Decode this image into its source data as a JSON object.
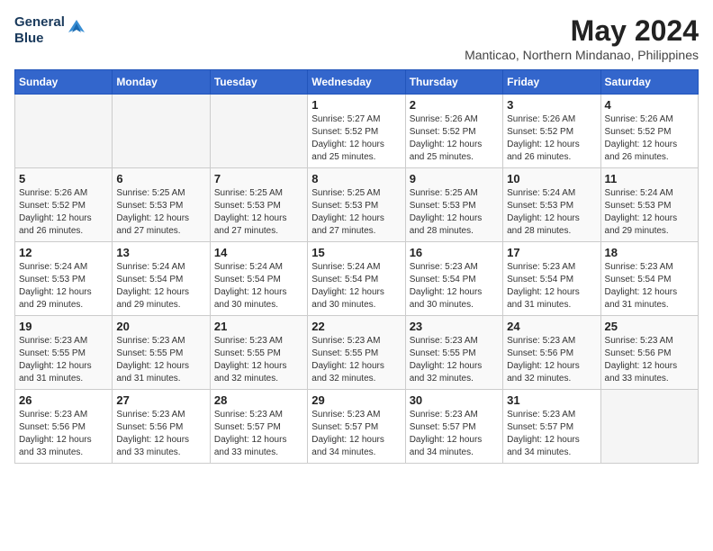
{
  "logo": {
    "line1": "General",
    "line2": "Blue"
  },
  "title": "May 2024",
  "location": "Manticao, Northern Mindanao, Philippines",
  "weekdays": [
    "Sunday",
    "Monday",
    "Tuesday",
    "Wednesday",
    "Thursday",
    "Friday",
    "Saturday"
  ],
  "weeks": [
    [
      {
        "day": "",
        "sunrise": "",
        "sunset": "",
        "daylight": ""
      },
      {
        "day": "",
        "sunrise": "",
        "sunset": "",
        "daylight": ""
      },
      {
        "day": "",
        "sunrise": "",
        "sunset": "",
        "daylight": ""
      },
      {
        "day": "1",
        "sunrise": "Sunrise: 5:27 AM",
        "sunset": "Sunset: 5:52 PM",
        "daylight": "Daylight: 12 hours and 25 minutes."
      },
      {
        "day": "2",
        "sunrise": "Sunrise: 5:26 AM",
        "sunset": "Sunset: 5:52 PM",
        "daylight": "Daylight: 12 hours and 25 minutes."
      },
      {
        "day": "3",
        "sunrise": "Sunrise: 5:26 AM",
        "sunset": "Sunset: 5:52 PM",
        "daylight": "Daylight: 12 hours and 26 minutes."
      },
      {
        "day": "4",
        "sunrise": "Sunrise: 5:26 AM",
        "sunset": "Sunset: 5:52 PM",
        "daylight": "Daylight: 12 hours and 26 minutes."
      }
    ],
    [
      {
        "day": "5",
        "sunrise": "Sunrise: 5:26 AM",
        "sunset": "Sunset: 5:52 PM",
        "daylight": "Daylight: 12 hours and 26 minutes."
      },
      {
        "day": "6",
        "sunrise": "Sunrise: 5:25 AM",
        "sunset": "Sunset: 5:53 PM",
        "daylight": "Daylight: 12 hours and 27 minutes."
      },
      {
        "day": "7",
        "sunrise": "Sunrise: 5:25 AM",
        "sunset": "Sunset: 5:53 PM",
        "daylight": "Daylight: 12 hours and 27 minutes."
      },
      {
        "day": "8",
        "sunrise": "Sunrise: 5:25 AM",
        "sunset": "Sunset: 5:53 PM",
        "daylight": "Daylight: 12 hours and 27 minutes."
      },
      {
        "day": "9",
        "sunrise": "Sunrise: 5:25 AM",
        "sunset": "Sunset: 5:53 PM",
        "daylight": "Daylight: 12 hours and 28 minutes."
      },
      {
        "day": "10",
        "sunrise": "Sunrise: 5:24 AM",
        "sunset": "Sunset: 5:53 PM",
        "daylight": "Daylight: 12 hours and 28 minutes."
      },
      {
        "day": "11",
        "sunrise": "Sunrise: 5:24 AM",
        "sunset": "Sunset: 5:53 PM",
        "daylight": "Daylight: 12 hours and 29 minutes."
      }
    ],
    [
      {
        "day": "12",
        "sunrise": "Sunrise: 5:24 AM",
        "sunset": "Sunset: 5:53 PM",
        "daylight": "Daylight: 12 hours and 29 minutes."
      },
      {
        "day": "13",
        "sunrise": "Sunrise: 5:24 AM",
        "sunset": "Sunset: 5:54 PM",
        "daylight": "Daylight: 12 hours and 29 minutes."
      },
      {
        "day": "14",
        "sunrise": "Sunrise: 5:24 AM",
        "sunset": "Sunset: 5:54 PM",
        "daylight": "Daylight: 12 hours and 30 minutes."
      },
      {
        "day": "15",
        "sunrise": "Sunrise: 5:24 AM",
        "sunset": "Sunset: 5:54 PM",
        "daylight": "Daylight: 12 hours and 30 minutes."
      },
      {
        "day": "16",
        "sunrise": "Sunrise: 5:23 AM",
        "sunset": "Sunset: 5:54 PM",
        "daylight": "Daylight: 12 hours and 30 minutes."
      },
      {
        "day": "17",
        "sunrise": "Sunrise: 5:23 AM",
        "sunset": "Sunset: 5:54 PM",
        "daylight": "Daylight: 12 hours and 31 minutes."
      },
      {
        "day": "18",
        "sunrise": "Sunrise: 5:23 AM",
        "sunset": "Sunset: 5:54 PM",
        "daylight": "Daylight: 12 hours and 31 minutes."
      }
    ],
    [
      {
        "day": "19",
        "sunrise": "Sunrise: 5:23 AM",
        "sunset": "Sunset: 5:55 PM",
        "daylight": "Daylight: 12 hours and 31 minutes."
      },
      {
        "day": "20",
        "sunrise": "Sunrise: 5:23 AM",
        "sunset": "Sunset: 5:55 PM",
        "daylight": "Daylight: 12 hours and 31 minutes."
      },
      {
        "day": "21",
        "sunrise": "Sunrise: 5:23 AM",
        "sunset": "Sunset: 5:55 PM",
        "daylight": "Daylight: 12 hours and 32 minutes."
      },
      {
        "day": "22",
        "sunrise": "Sunrise: 5:23 AM",
        "sunset": "Sunset: 5:55 PM",
        "daylight": "Daylight: 12 hours and 32 minutes."
      },
      {
        "day": "23",
        "sunrise": "Sunrise: 5:23 AM",
        "sunset": "Sunset: 5:55 PM",
        "daylight": "Daylight: 12 hours and 32 minutes."
      },
      {
        "day": "24",
        "sunrise": "Sunrise: 5:23 AM",
        "sunset": "Sunset: 5:56 PM",
        "daylight": "Daylight: 12 hours and 32 minutes."
      },
      {
        "day": "25",
        "sunrise": "Sunrise: 5:23 AM",
        "sunset": "Sunset: 5:56 PM",
        "daylight": "Daylight: 12 hours and 33 minutes."
      }
    ],
    [
      {
        "day": "26",
        "sunrise": "Sunrise: 5:23 AM",
        "sunset": "Sunset: 5:56 PM",
        "daylight": "Daylight: 12 hours and 33 minutes."
      },
      {
        "day": "27",
        "sunrise": "Sunrise: 5:23 AM",
        "sunset": "Sunset: 5:56 PM",
        "daylight": "Daylight: 12 hours and 33 minutes."
      },
      {
        "day": "28",
        "sunrise": "Sunrise: 5:23 AM",
        "sunset": "Sunset: 5:57 PM",
        "daylight": "Daylight: 12 hours and 33 minutes."
      },
      {
        "day": "29",
        "sunrise": "Sunrise: 5:23 AM",
        "sunset": "Sunset: 5:57 PM",
        "daylight": "Daylight: 12 hours and 34 minutes."
      },
      {
        "day": "30",
        "sunrise": "Sunrise: 5:23 AM",
        "sunset": "Sunset: 5:57 PM",
        "daylight": "Daylight: 12 hours and 34 minutes."
      },
      {
        "day": "31",
        "sunrise": "Sunrise: 5:23 AM",
        "sunset": "Sunset: 5:57 PM",
        "daylight": "Daylight: 12 hours and 34 minutes."
      },
      {
        "day": "",
        "sunrise": "",
        "sunset": "",
        "daylight": ""
      }
    ]
  ]
}
